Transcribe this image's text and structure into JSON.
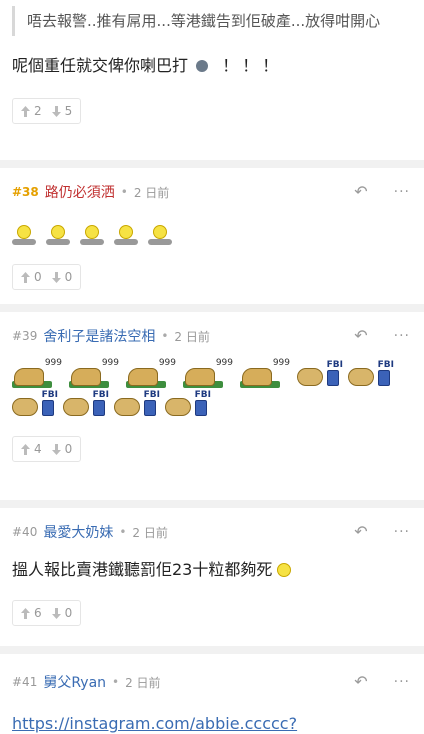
{
  "top": {
    "quote": "唔去報警..推有屌用...等港鐵告到佢破產...放得咁開心",
    "body": "呢個重任就交俾你喇巴打",
    "body_suffix": "！！！",
    "up": "2",
    "down": "5"
  },
  "posts": [
    {
      "num": "#38",
      "user": "路仍必須洒",
      "time": "2 日前",
      "up": "0",
      "down": "0"
    },
    {
      "num": "#39",
      "user": "舍利子是諸法空相",
      "time": "2 日前",
      "up": "4",
      "down": "0",
      "dog_tag": "999",
      "fbi_tag": "FBI"
    },
    {
      "num": "#40",
      "user": "最愛大奶妹",
      "time": "2 日前",
      "body": "搵人報比賣港鐵聽罰佢23十粒都夠死",
      "up": "6",
      "down": "0"
    },
    {
      "num": "#41",
      "user": "舅父Ryan",
      "time": "2 日前",
      "link": "https://instagram.com/abbie.ccccc?"
    }
  ],
  "separator_dot": "•",
  "icons": {
    "reply": "reply-arrow",
    "more": "more-dots",
    "up": "up-arrow",
    "down": "down-arrow"
  },
  "colors": {
    "accent": "#3a6cb3",
    "hot_number": "#e5a000",
    "red_user": "#c03030"
  }
}
